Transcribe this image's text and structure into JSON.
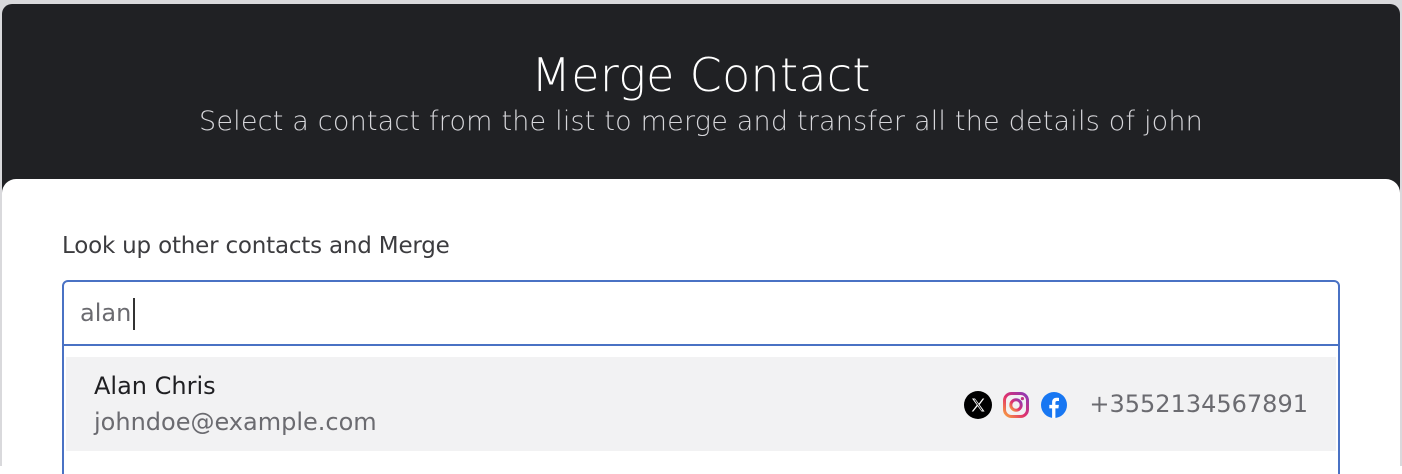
{
  "modal": {
    "title": "Merge Contact",
    "subtitle": "Select a contact from the list to merge and transfer all the details of john"
  },
  "lookup": {
    "label": "Look up other contacts and Merge",
    "value": "alan",
    "placeholder": ""
  },
  "results": [
    {
      "name": "Alan Chris",
      "email": "johndoe@example.com",
      "phone": "+3552134567891",
      "social_icons": [
        "x-icon",
        "instagram-icon",
        "facebook-icon"
      ]
    }
  ],
  "colors": {
    "header_bg": "#202124",
    "focus_border": "#4a72c4",
    "result_bg": "#f2f2f3",
    "facebook": "#1877f2"
  }
}
